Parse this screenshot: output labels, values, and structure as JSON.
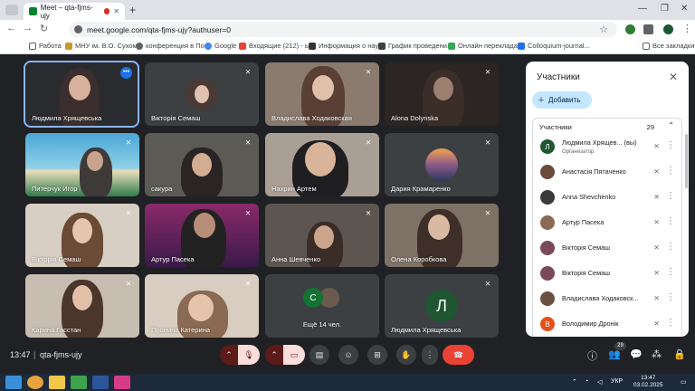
{
  "browser": {
    "tab_title": "Meet – qta-fjms-ujy",
    "url": "meet.google.com/qta-fjms-ujy?authuser=0",
    "bookmarks": [
      "Работа",
      "МНУ ім. В.О. Сухом...",
      "конференция в По...",
      "Google",
      "Входящие (212) - ь...",
      "Информация о нау...",
      "График проведени...",
      "Онлайн перекладa...",
      "Colloquium-journal...",
      "Все закладки"
    ]
  },
  "tiles": [
    {
      "name": "Людмила Хрящевська"
    },
    {
      "name": "Вікторія Семаш"
    },
    {
      "name": "Владислава Ходаковская"
    },
    {
      "name": "Alona Dolynska"
    },
    {
      "name": "Питерчук Игор"
    },
    {
      "name": "сакура"
    },
    {
      "name": "Нахрин Артем"
    },
    {
      "name": "Дария Крамаренко"
    },
    {
      "name": "Вікторія Семаш"
    },
    {
      "name": "Артур Пасека"
    },
    {
      "name": "Анна Шевченко"
    },
    {
      "name": "Олена Коробкова"
    },
    {
      "name": "Карина Гасстан"
    },
    {
      "name": "Пронина Катерина"
    },
    {
      "name": "Ещё 14 чел.",
      "avatar_letter": "С"
    },
    {
      "name": "Людмила Хрящевська",
      "avatar_letter": "Л"
    }
  ],
  "panel": {
    "title": "Участники",
    "add_label": "Добавить",
    "section_label": "Участники",
    "count": "29",
    "participants": [
      {
        "name": "Людмила Хрящев... (вы)",
        "sub": "Организатор",
        "letter": "Л",
        "color": "#1e5631"
      },
      {
        "name": "Анастасія Пятаченко",
        "sub": "",
        "letter": "",
        "color": "#6b4a3a"
      },
      {
        "name": "Anna Shevchenko",
        "sub": "",
        "letter": "",
        "color": "#3a3a3a"
      },
      {
        "name": "Артур Пасека",
        "sub": "",
        "letter": "",
        "color": "#8a6a55"
      },
      {
        "name": "Вікторія Семаш",
        "sub": "",
        "letter": "",
        "color": "#7a4a5a"
      },
      {
        "name": "Вікторія Семаш",
        "sub": "",
        "letter": "",
        "color": "#7a4a5a"
      },
      {
        "name": "Владислава Ходаковск...",
        "sub": "",
        "letter": "",
        "color": "#6a5040"
      },
      {
        "name": "Володимир Дронік",
        "sub": "",
        "letter": "В",
        "color": "#e8501a"
      }
    ]
  },
  "bottom": {
    "time": "13:47",
    "separator": "|",
    "meeting_code": "qta-fjms-ujy",
    "people_badge": "29"
  },
  "taskbar": {
    "lang": "УКР",
    "clock_time": "13:47",
    "clock_date": "03.02.2025"
  }
}
